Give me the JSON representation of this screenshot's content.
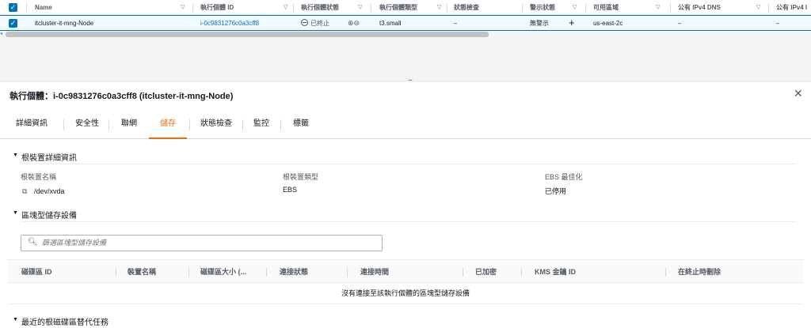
{
  "table": {
    "columns": [
      "Name",
      "執行個體 ID",
      "執行個體狀態",
      "執行個體類型",
      "狀態檢查",
      "警示狀態",
      "可用區域",
      "公有 IPv4 DNS",
      "公有 IPv4 I"
    ],
    "row": {
      "name": "itcluster-it-mng-Node",
      "instance_id": "i-0c9831276c0a3cff8",
      "state": "已終止",
      "type": "t3.small",
      "status_check": "–",
      "alarm": "無警示",
      "az": "us-east-2c",
      "dns": "–",
      "ipv4": "–"
    }
  },
  "panel": {
    "title": "執行個體：i-0c9831276c0a3cff8 (itcluster-it-mng-Node)",
    "tabs": [
      "詳細資訊",
      "安全性",
      "聯網",
      "儲存",
      "狀態檢查",
      "監控",
      "標籤"
    ],
    "active_tab": "儲存",
    "root_device": {
      "heading": "根裝置詳細資訊",
      "name_label": "根裝置名稱",
      "name_value": "/dev/xvda",
      "type_label": "根裝置類型",
      "type_value": "EBS",
      "ebs_label": "EBS 最佳化",
      "ebs_value": "已停用"
    },
    "block_storage": {
      "heading": "區塊型儲存設備",
      "search_placeholder": "篩選區塊型儲存設備",
      "columns": [
        "磁碟區 ID",
        "裝置名稱",
        "磁碟區大小 (...",
        "連接狀態",
        "連接時間",
        "已加密",
        "KMS 金鑰 ID",
        "在終止時刪除"
      ],
      "empty_message": "沒有連接至該執行個體的區塊型儲存設備"
    },
    "replacement": {
      "heading": "最近的根磁碟區替代任務"
    }
  },
  "colors": {
    "accent": "#ec7211",
    "link": "#0073bb"
  }
}
